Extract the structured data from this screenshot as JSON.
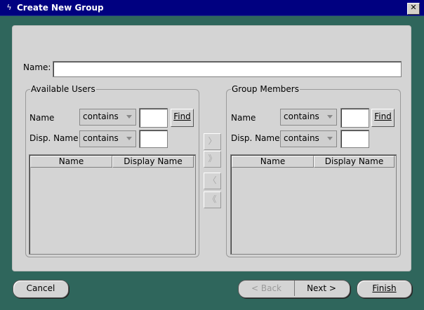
{
  "window": {
    "title": "Create New Group",
    "close_glyph": "✕"
  },
  "name_field": {
    "label": "Name:",
    "value": ""
  },
  "available_users": {
    "title": "Available Users",
    "name_label": "Name",
    "name_filter": "contains",
    "disp_label": "Disp. Name",
    "disp_filter": "contains",
    "find_label": "Find",
    "columns": [
      "Name",
      "Display Name"
    ]
  },
  "group_members": {
    "title": "Group Members",
    "name_label": "Name",
    "name_filter": "contains",
    "disp_label": "Disp. Name",
    "disp_filter": "contains",
    "find_label": "Find",
    "columns": [
      "Name",
      "Display Name"
    ]
  },
  "transfer": {
    "add_glyph": "〉",
    "add_all_glyph": "》",
    "remove_glyph": "〈",
    "remove_all_glyph": "《"
  },
  "footer": {
    "cancel": "Cancel",
    "back": "< Back",
    "next": "Next >",
    "finish": "Finish"
  },
  "colors": {
    "title_bar": "#000080",
    "desktop": "#2f665c",
    "panel": "#d4d4d4"
  }
}
